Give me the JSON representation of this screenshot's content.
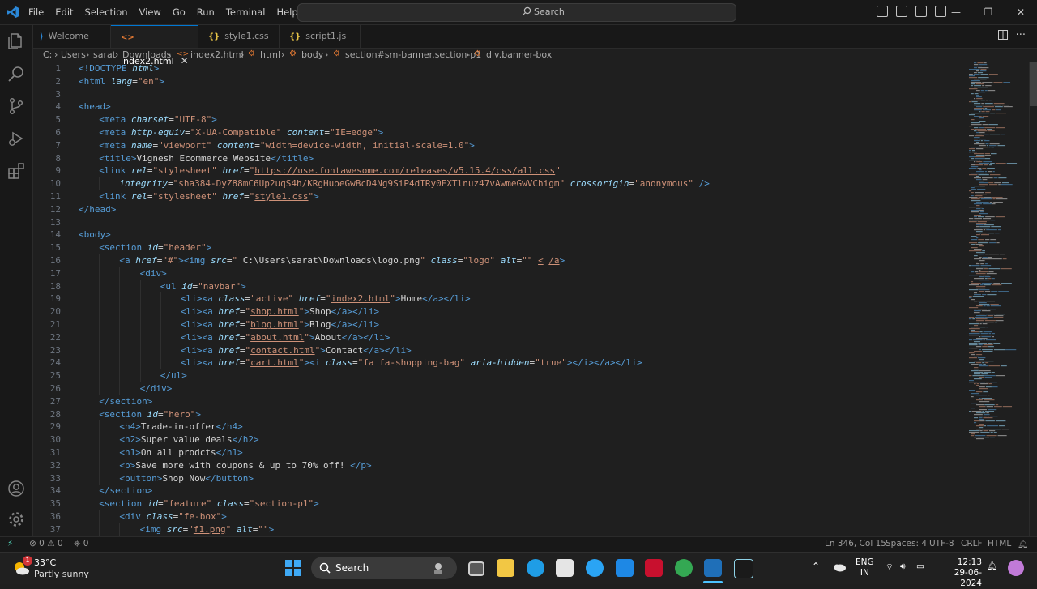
{
  "menu": [
    "File",
    "Edit",
    "Selection",
    "View",
    "Go",
    "Run",
    "Terminal",
    "Help"
  ],
  "search_placeholder": "Search",
  "tabs": [
    {
      "label": "Welcome",
      "icon": "vscode-icon",
      "active": false
    },
    {
      "label": "index2.html",
      "icon": "html-icon",
      "active": true
    },
    {
      "label": "style1.css",
      "icon": "css-icon",
      "active": false
    },
    {
      "label": "script1.js",
      "icon": "js-icon",
      "active": false
    }
  ],
  "breadcrumb": [
    "C:",
    "Users",
    "sarat",
    "Downloads",
    "index2.html",
    "html",
    "body",
    "section#sm-banner.section-p1",
    "div.banner-box"
  ],
  "code_lines": [
    {
      "n": "1",
      "indent": 0,
      "t": [
        [
          "tk",
          "<!DOCTYPE "
        ],
        [
          "at",
          "html"
        ],
        [
          "tk",
          ">"
        ]
      ]
    },
    {
      "n": "2",
      "indent": 0,
      "t": [
        [
          "tk",
          "<html "
        ],
        [
          "at",
          "lang"
        ],
        [
          "tx",
          "="
        ],
        [
          "st",
          "\"en\""
        ],
        [
          "tk",
          ">"
        ]
      ]
    },
    {
      "n": "3",
      "indent": 0,
      "t": []
    },
    {
      "n": "4",
      "indent": 0,
      "t": [
        [
          "tk",
          "<head>"
        ]
      ]
    },
    {
      "n": "5",
      "indent": 1,
      "t": [
        [
          "tk",
          "<meta "
        ],
        [
          "at",
          "charset"
        ],
        [
          "tx",
          "="
        ],
        [
          "st",
          "\"UTF-8\""
        ],
        [
          "tk",
          ">"
        ]
      ]
    },
    {
      "n": "6",
      "indent": 1,
      "t": [
        [
          "tk",
          "<meta "
        ],
        [
          "at",
          "http-equiv"
        ],
        [
          "tx",
          "="
        ],
        [
          "st",
          "\"X-UA-Compatible\""
        ],
        [
          "tx",
          " "
        ],
        [
          "at",
          "content"
        ],
        [
          "tx",
          "="
        ],
        [
          "st",
          "\"IE=edge\""
        ],
        [
          "tk",
          ">"
        ]
      ]
    },
    {
      "n": "7",
      "indent": 1,
      "t": [
        [
          "tk",
          "<meta "
        ],
        [
          "at",
          "name"
        ],
        [
          "tx",
          "="
        ],
        [
          "st",
          "\"viewport\""
        ],
        [
          "tx",
          " "
        ],
        [
          "at",
          "content"
        ],
        [
          "tx",
          "="
        ],
        [
          "st",
          "\"width=device-width, initial-scale=1.0\""
        ],
        [
          "tk",
          ">"
        ]
      ]
    },
    {
      "n": "8",
      "indent": 1,
      "t": [
        [
          "tk",
          "<title>"
        ],
        [
          "tx",
          "Vignesh Ecommerce Website"
        ],
        [
          "tk",
          "</title>"
        ]
      ]
    },
    {
      "n": "9",
      "indent": 1,
      "t": [
        [
          "tk",
          "<link "
        ],
        [
          "at",
          "rel"
        ],
        [
          "tx",
          "="
        ],
        [
          "st",
          "\"stylesheet\""
        ],
        [
          "tx",
          " "
        ],
        [
          "at",
          "href"
        ],
        [
          "tx",
          "="
        ],
        [
          "st",
          "\""
        ],
        [
          "lk",
          "https://use.fontawesome.com/releases/v5.15.4/css/all.css"
        ],
        [
          "st",
          "\""
        ]
      ]
    },
    {
      "n": "10",
      "indent": 2,
      "t": [
        [
          "at",
          "integrity"
        ],
        [
          "tx",
          "="
        ],
        [
          "st",
          "\"sha384-DyZ88mC6Up2uqS4h/KRgHuoeGwBcD4Ng9SiP4dIRy0EXTlnuz47vAwmeGwVChigm\""
        ],
        [
          "tx",
          " "
        ],
        [
          "at",
          "crossorigin"
        ],
        [
          "tx",
          "="
        ],
        [
          "st",
          "\"anonymous\""
        ],
        [
          "tx",
          " "
        ],
        [
          "tk",
          "/>"
        ]
      ]
    },
    {
      "n": "11",
      "indent": 1,
      "t": [
        [
          "tk",
          "<link "
        ],
        [
          "at",
          "rel"
        ],
        [
          "tx",
          "="
        ],
        [
          "st",
          "\"stylesheet\""
        ],
        [
          "tx",
          " "
        ],
        [
          "at",
          "href"
        ],
        [
          "tx",
          "="
        ],
        [
          "st",
          "\""
        ],
        [
          "lk",
          "style1.css"
        ],
        [
          "st",
          "\""
        ],
        [
          "tk",
          ">"
        ]
      ]
    },
    {
      "n": "12",
      "indent": 0,
      "t": [
        [
          "tk",
          "</head>"
        ]
      ]
    },
    {
      "n": "13",
      "indent": 0,
      "t": []
    },
    {
      "n": "14",
      "indent": 0,
      "t": [
        [
          "tk",
          "<body>"
        ]
      ]
    },
    {
      "n": "15",
      "indent": 1,
      "t": [
        [
          "tk",
          "<section "
        ],
        [
          "at",
          "id"
        ],
        [
          "tx",
          "="
        ],
        [
          "st",
          "\"header\""
        ],
        [
          "tk",
          ">"
        ]
      ]
    },
    {
      "n": "16",
      "indent": 2,
      "t": [
        [
          "tk",
          "<a "
        ],
        [
          "at",
          "href"
        ],
        [
          "tx",
          "="
        ],
        [
          "st",
          "\"#\""
        ],
        [
          "tk",
          "><img "
        ],
        [
          "at",
          "src"
        ],
        [
          "tx",
          "="
        ],
        [
          "st",
          "\" "
        ],
        [
          "tx",
          "C:\\Users\\sarat\\Downloads\\logo.png"
        ],
        [
          "st",
          "\""
        ],
        [
          "tx",
          " "
        ],
        [
          "at",
          "class"
        ],
        [
          "tx",
          "="
        ],
        [
          "st",
          "\"logo\""
        ],
        [
          "tx",
          " "
        ],
        [
          "at",
          "alt"
        ],
        [
          "tx",
          "="
        ],
        [
          "st",
          "\"\""
        ],
        [
          "tx",
          " "
        ],
        [
          "lk",
          "<"
        ],
        [
          "tx",
          " "
        ],
        [
          "lk",
          "/a"
        ],
        [
          "tk",
          ">"
        ]
      ]
    },
    {
      "n": "17",
      "indent": 3,
      "t": [
        [
          "tk",
          "<div>"
        ]
      ]
    },
    {
      "n": "18",
      "indent": 4,
      "t": [
        [
          "tk",
          "<ul "
        ],
        [
          "at",
          "id"
        ],
        [
          "tx",
          "="
        ],
        [
          "st",
          "\"navbar\""
        ],
        [
          "tk",
          ">"
        ]
      ]
    },
    {
      "n": "19",
      "indent": 5,
      "t": [
        [
          "tk",
          "<li><a "
        ],
        [
          "at",
          "class"
        ],
        [
          "tx",
          "="
        ],
        [
          "st",
          "\"active\""
        ],
        [
          "tx",
          " "
        ],
        [
          "at",
          "href"
        ],
        [
          "tx",
          "="
        ],
        [
          "st",
          "\""
        ],
        [
          "lk",
          "index2.html"
        ],
        [
          "st",
          "\""
        ],
        [
          "tk",
          ">"
        ],
        [
          "tx",
          "Home"
        ],
        [
          "tk",
          "</a></li>"
        ]
      ]
    },
    {
      "n": "20",
      "indent": 5,
      "t": [
        [
          "tk",
          "<li><a "
        ],
        [
          "at",
          "href"
        ],
        [
          "tx",
          "="
        ],
        [
          "st",
          "\""
        ],
        [
          "lk",
          "shop.html"
        ],
        [
          "st",
          "\""
        ],
        [
          "tk",
          ">"
        ],
        [
          "tx",
          "Shop"
        ],
        [
          "tk",
          "</a></li>"
        ]
      ]
    },
    {
      "n": "21",
      "indent": 5,
      "t": [
        [
          "tk",
          "<li><a "
        ],
        [
          "at",
          "href"
        ],
        [
          "tx",
          "="
        ],
        [
          "st",
          "\""
        ],
        [
          "lk",
          "blog.html"
        ],
        [
          "st",
          "\""
        ],
        [
          "tk",
          ">"
        ],
        [
          "tx",
          "Blog"
        ],
        [
          "tk",
          "</a></li>"
        ]
      ]
    },
    {
      "n": "22",
      "indent": 5,
      "t": [
        [
          "tk",
          "<li><a "
        ],
        [
          "at",
          "href"
        ],
        [
          "tx",
          "="
        ],
        [
          "st",
          "\""
        ],
        [
          "lk",
          "about.html"
        ],
        [
          "st",
          "\""
        ],
        [
          "tk",
          ">"
        ],
        [
          "tx",
          "About"
        ],
        [
          "tk",
          "</a></li>"
        ]
      ]
    },
    {
      "n": "23",
      "indent": 5,
      "t": [
        [
          "tk",
          "<li><a "
        ],
        [
          "at",
          "href"
        ],
        [
          "tx",
          "="
        ],
        [
          "st",
          "\""
        ],
        [
          "lk",
          "contact.html"
        ],
        [
          "st",
          "\""
        ],
        [
          "tk",
          ">"
        ],
        [
          "tx",
          "Contact"
        ],
        [
          "tk",
          "</a></li>"
        ]
      ]
    },
    {
      "n": "24",
      "indent": 5,
      "t": [
        [
          "tk",
          "<li><a "
        ],
        [
          "at",
          "href"
        ],
        [
          "tx",
          "="
        ],
        [
          "st",
          "\""
        ],
        [
          "lk",
          "cart.html"
        ],
        [
          "st",
          "\""
        ],
        [
          "tk",
          "><i "
        ],
        [
          "at",
          "class"
        ],
        [
          "tx",
          "="
        ],
        [
          "st",
          "\"fa fa-shopping-bag\""
        ],
        [
          "tx",
          " "
        ],
        [
          "at",
          "aria-hidden"
        ],
        [
          "tx",
          "="
        ],
        [
          "st",
          "\"true\""
        ],
        [
          "tk",
          "></i></a></li>"
        ]
      ]
    },
    {
      "n": "25",
      "indent": 4,
      "t": [
        [
          "tk",
          "</ul>"
        ]
      ]
    },
    {
      "n": "26",
      "indent": 3,
      "t": [
        [
          "tk",
          "</div>"
        ]
      ]
    },
    {
      "n": "27",
      "indent": 1,
      "t": [
        [
          "tk",
          "</section>"
        ]
      ]
    },
    {
      "n": "28",
      "indent": 1,
      "t": [
        [
          "tk",
          "<section "
        ],
        [
          "at",
          "id"
        ],
        [
          "tx",
          "="
        ],
        [
          "st",
          "\"hero\""
        ],
        [
          "tk",
          ">"
        ]
      ]
    },
    {
      "n": "29",
      "indent": 2,
      "t": [
        [
          "tk",
          "<h4>"
        ],
        [
          "tx",
          "Trade-in-offer"
        ],
        [
          "tk",
          "</h4>"
        ]
      ]
    },
    {
      "n": "30",
      "indent": 2,
      "t": [
        [
          "tk",
          "<h2>"
        ],
        [
          "tx",
          "Super value deals"
        ],
        [
          "tk",
          "</h2>"
        ]
      ]
    },
    {
      "n": "31",
      "indent": 2,
      "t": [
        [
          "tk",
          "<h1>"
        ],
        [
          "tx",
          "On all prodcts"
        ],
        [
          "tk",
          "</h1>"
        ]
      ]
    },
    {
      "n": "32",
      "indent": 2,
      "t": [
        [
          "tk",
          "<p>"
        ],
        [
          "tx",
          "Save more with coupons & up to 70% off! "
        ],
        [
          "tk",
          "</p>"
        ]
      ]
    },
    {
      "n": "33",
      "indent": 2,
      "t": [
        [
          "tk",
          "<button>"
        ],
        [
          "tx",
          "Shop Now"
        ],
        [
          "tk",
          "</button>"
        ]
      ]
    },
    {
      "n": "34",
      "indent": 1,
      "t": [
        [
          "tk",
          "</section>"
        ]
      ]
    },
    {
      "n": "35",
      "indent": 1,
      "t": [
        [
          "tk",
          "<section "
        ],
        [
          "at",
          "id"
        ],
        [
          "tx",
          "="
        ],
        [
          "st",
          "\"feature\""
        ],
        [
          "tx",
          " "
        ],
        [
          "at",
          "class"
        ],
        [
          "tx",
          "="
        ],
        [
          "st",
          "\"section-p1\""
        ],
        [
          "tk",
          ">"
        ]
      ]
    },
    {
      "n": "36",
      "indent": 2,
      "t": [
        [
          "tk",
          "<div "
        ],
        [
          "at",
          "class"
        ],
        [
          "tx",
          "="
        ],
        [
          "st",
          "\"fe-box\""
        ],
        [
          "tk",
          ">"
        ]
      ]
    },
    {
      "n": "37",
      "indent": 3,
      "t": [
        [
          "tk",
          "<img "
        ],
        [
          "at",
          "src"
        ],
        [
          "tx",
          "="
        ],
        [
          "st",
          "\""
        ],
        [
          "lk",
          "f1.png"
        ],
        [
          "st",
          "\""
        ],
        [
          "tx",
          " "
        ],
        [
          "at",
          "alt"
        ],
        [
          "tx",
          "="
        ],
        [
          "st",
          "\"\""
        ],
        [
          "tk",
          ">"
        ]
      ]
    }
  ],
  "status": {
    "errors": "0",
    "warnings": "0",
    "ports": "0",
    "position": "Ln 346, Col 15",
    "spaces": "Spaces: 4",
    "encoding": "UTF-8",
    "eol": "CRLF",
    "language": "HTML"
  },
  "taskbar": {
    "weather_temp": "33°C",
    "weather_desc": "Partly sunny",
    "weather_badge": "1",
    "search": "Search",
    "lang": "ENG",
    "region": "IN",
    "time": "12:13",
    "date": "29-06-2024"
  },
  "colors": {
    "accent": "#0078d4",
    "tag": "#569cd6",
    "attr": "#9cdcfe",
    "string": "#ce9178"
  }
}
